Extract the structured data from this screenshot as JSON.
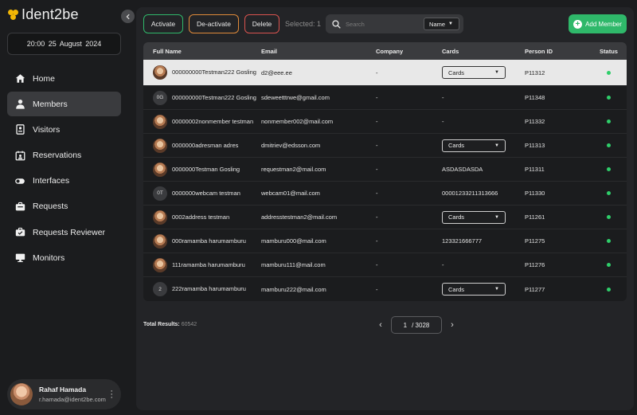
{
  "app": {
    "logo_text": "Ident2be"
  },
  "sidebar": {
    "datetime": "20:00   25 August 2024",
    "nav": [
      {
        "label": "Home",
        "icon": "home-icon"
      },
      {
        "label": "Members",
        "icon": "person-icon",
        "active": true
      },
      {
        "label": "Visitors",
        "icon": "visitor-badge-icon"
      },
      {
        "label": "Reservations",
        "icon": "calendar-person-icon"
      },
      {
        "label": "Interfaces",
        "icon": "toggle-icon"
      },
      {
        "label": "Requests",
        "icon": "briefcase-icon"
      },
      {
        "label": "Requests Reviewer",
        "icon": "briefcase-check-icon"
      },
      {
        "label": "Monitors",
        "icon": "monitor-icon"
      }
    ],
    "user": {
      "name": "Rahaf Hamada",
      "email": "r.hamada@ident2be.com"
    }
  },
  "toolbar": {
    "activate_label": "Activate",
    "deactivate_label": "De-activate",
    "delete_label": "Delete",
    "selected_text": "Selected: 1",
    "search_placeholder": "Search",
    "search_field": "Name",
    "add_label": "Add Member"
  },
  "table": {
    "columns": [
      "Full Name",
      "Email",
      "Company",
      "Cards",
      "Person ID",
      "Status"
    ],
    "rows": [
      {
        "name": "000000000Testman222 Gosling",
        "avatar": "photo",
        "email": "d2@eee.ee",
        "company": "-",
        "cards": "Cards",
        "cards_select": true,
        "pid": "P11312",
        "status": "active"
      },
      {
        "name": "000000000Testman222 Gosling",
        "avatar": "initials",
        "initials": "0G",
        "email": "sdeweetttrwe@gmail.com",
        "company": "-",
        "cards": "-",
        "cards_select": false,
        "pid": "P11348",
        "status": "active"
      },
      {
        "name": "00000002nonmember testman",
        "avatar": "photo",
        "email": "nonmember002@mail.com",
        "company": "-",
        "cards": "-",
        "cards_select": false,
        "pid": "P11332",
        "status": "active"
      },
      {
        "name": "0000000adresman adres",
        "avatar": "photo",
        "email": "dmitriev@edsson.com",
        "company": "-",
        "cards": "Cards",
        "cards_select": true,
        "pid": "P11313",
        "status": "active"
      },
      {
        "name": "0000000Testman Gosling",
        "avatar": "photo",
        "email": "requestman2@mail.com",
        "company": "-",
        "cards": "ASDASDASDA",
        "cards_select": false,
        "pid": "P11311",
        "status": "active"
      },
      {
        "name": "0000000webcam testman",
        "avatar": "initials",
        "initials": "0T",
        "email": "webcam01@mail.com",
        "company": "-",
        "cards": "00001233211313666",
        "cards_select": false,
        "pid": "P11330",
        "status": "active"
      },
      {
        "name": "0002address testman",
        "avatar": "photo",
        "email": "addresstestman2@mail.com",
        "company": "-",
        "cards": "Cards",
        "cards_select": true,
        "pid": "P11261",
        "status": "active"
      },
      {
        "name": "000ramamba harumamburu",
        "avatar": "photo",
        "email": "mamburu000@mail.com",
        "company": "-",
        "cards": "123321666777",
        "cards_select": false,
        "pid": "P11275",
        "status": "active"
      },
      {
        "name": "111ramamba harumamburu",
        "avatar": "photo",
        "email": "mamburu111@mail.com",
        "company": "-",
        "cards": "-",
        "cards_select": false,
        "pid": "P11276",
        "status": "active"
      },
      {
        "name": "222ramamba harumamburu",
        "avatar": "initials",
        "initials": "2",
        "email": "mamburu222@mail.com",
        "company": "-",
        "cards": "Cards",
        "cards_select": true,
        "pid": "P11277",
        "status": "active"
      }
    ]
  },
  "footer": {
    "total_label": "Total Results:",
    "total_value": "60542",
    "current_page": "1",
    "total_pages": "/  3028"
  },
  "colors": {
    "accent_green": "#2fb86a",
    "deactivate_orange": "#e08a3a",
    "delete_red": "#d9534f",
    "status_active": "#2fce6a",
    "logo_yellow": "#f2b705"
  }
}
